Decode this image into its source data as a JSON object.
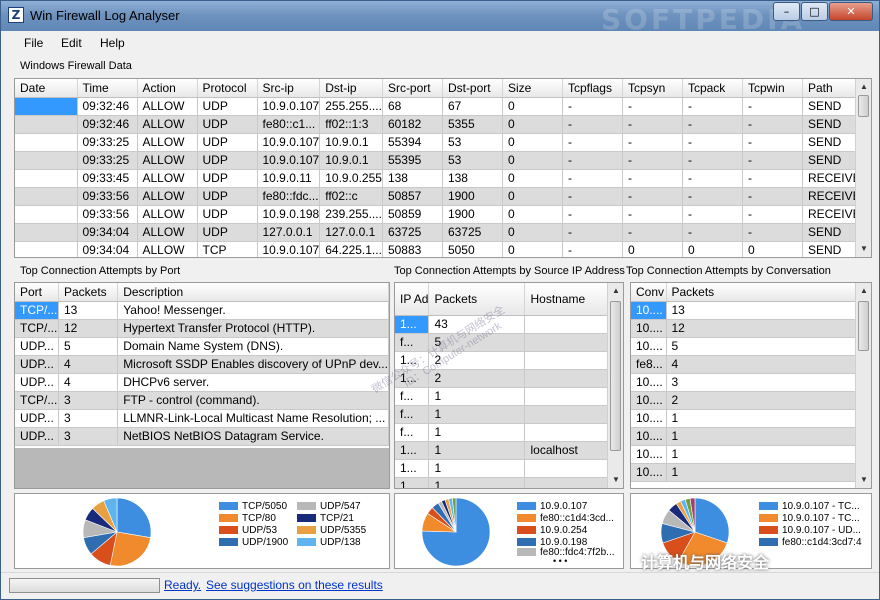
{
  "window": {
    "title": "Win Firewall Log Analyser",
    "icon": "Z",
    "watermark": "SOFTPEDIA"
  },
  "menu": [
    "File",
    "Edit",
    "Help"
  ],
  "log": {
    "label": "Windows Firewall Data",
    "columns": [
      "Date",
      "Time",
      "Action",
      "Protocol",
      "Src-ip",
      "Dst-ip",
      "Src-port",
      "Dst-port",
      "Size",
      "Tcpflags",
      "Tcpsyn",
      "Tcpack",
      "Tcpwin",
      "Path"
    ],
    "rows": [
      [
        "",
        "09:32:46",
        "ALLOW",
        "UDP",
        "10.9.0.107",
        "255.255....",
        "68",
        "67",
        "0",
        "-",
        "-",
        "-",
        "-",
        "SEND"
      ],
      [
        "",
        "09:32:46",
        "ALLOW",
        "UDP",
        "fe80::c1...",
        "ff02::1:3",
        "60182",
        "5355",
        "0",
        "-",
        "-",
        "-",
        "-",
        "SEND"
      ],
      [
        "",
        "09:33:25",
        "ALLOW",
        "UDP",
        "10.9.0.107",
        "10.9.0.1",
        "55394",
        "53",
        "0",
        "-",
        "-",
        "-",
        "-",
        "SEND"
      ],
      [
        "",
        "09:33:25",
        "ALLOW",
        "UDP",
        "10.9.0.107",
        "10.9.0.1",
        "55395",
        "53",
        "0",
        "-",
        "-",
        "-",
        "-",
        "SEND"
      ],
      [
        "",
        "09:33:45",
        "ALLOW",
        "UDP",
        "10.9.0.11",
        "10.9.0.255",
        "138",
        "138",
        "0",
        "-",
        "-",
        "-",
        "-",
        "RECEIVE"
      ],
      [
        "",
        "09:33:56",
        "ALLOW",
        "UDP",
        "fe80::fdc...",
        "ff02::c",
        "50857",
        "1900",
        "0",
        "-",
        "-",
        "-",
        "-",
        "RECEIVE"
      ],
      [
        "",
        "09:33:56",
        "ALLOW",
        "UDP",
        "10.9.0.198",
        "239.255....",
        "50859",
        "1900",
        "0",
        "-",
        "-",
        "-",
        "-",
        "RECEIVE"
      ],
      [
        "",
        "09:34:04",
        "ALLOW",
        "UDP",
        "127.0.0.1",
        "127.0.0.1",
        "63725",
        "63725",
        "0",
        "-",
        "-",
        "-",
        "-",
        "SEND"
      ],
      [
        "",
        "09:34:04",
        "ALLOW",
        "TCP",
        "10.9.0.107",
        "64.225.1...",
        "50883",
        "5050",
        "0",
        "-",
        "0",
        "0",
        "0",
        "SEND"
      ]
    ]
  },
  "by_port": {
    "label": "Top Connection Attempts by Port",
    "columns": [
      "Port",
      "Packets",
      "Description"
    ],
    "rows": [
      [
        "TCP/...",
        "13",
        "Yahoo! Messenger."
      ],
      [
        "TCP/...",
        "12",
        "Hypertext Transfer Protocol (HTTP)."
      ],
      [
        "UDP...",
        "5",
        "Domain Name System (DNS)."
      ],
      [
        "UDP...",
        "4",
        "Microsoft SSDP Enables discovery of UPnP dev..."
      ],
      [
        "UDP...",
        "4",
        "DHCPv6 server."
      ],
      [
        "TCP/...",
        "3",
        "FTP - control (command)."
      ],
      [
        "UDP...",
        "3",
        "LLMNR-Link-Local Multicast Name Resolution; ..."
      ],
      [
        "UDP...",
        "3",
        "NetBIOS NetBIOS Datagram Service."
      ]
    ]
  },
  "by_ip": {
    "label": "Top Connection Attempts by Source IP Address",
    "columns": [
      "IP Ad",
      "Packets",
      "Hostname"
    ],
    "rows": [
      [
        "1...",
        "43",
        ""
      ],
      [
        "f...",
        "5",
        ""
      ],
      [
        "1...",
        "2",
        ""
      ],
      [
        "1...",
        "2",
        ""
      ],
      [
        "f...",
        "1",
        ""
      ],
      [
        "f...",
        "1",
        ""
      ],
      [
        "f...",
        "1",
        ""
      ],
      [
        "1...",
        "1",
        "localhost"
      ],
      [
        "1...",
        "1",
        ""
      ],
      [
        "1...",
        "1",
        ""
      ]
    ]
  },
  "by_conv": {
    "label": "Top Connection Attempts by Conversation",
    "columns": [
      "Conv",
      "Packets"
    ],
    "rows": [
      [
        "10....",
        "13"
      ],
      [
        "10....",
        "12"
      ],
      [
        "10....",
        "5"
      ],
      [
        "fe8...",
        "4"
      ],
      [
        "10....",
        "3"
      ],
      [
        "10....",
        "2"
      ],
      [
        "10....",
        "1"
      ],
      [
        "10....",
        "1"
      ],
      [
        "10....",
        "1"
      ],
      [
        "10....",
        "1"
      ]
    ]
  },
  "pie_port": {
    "legend": [
      {
        "label": "TCP/5050",
        "color": "#3d8ee0"
      },
      {
        "label": "UDP/547",
        "color": "#b8b8b8"
      },
      {
        "label": "TCP/80",
        "color": "#f08a2c"
      },
      {
        "label": "TCP/21",
        "color": "#1a2a7a"
      },
      {
        "label": "UDP/53",
        "color": "#d84f1c"
      },
      {
        "label": "UDP/5355",
        "color": "#e8a040"
      },
      {
        "label": "UDP/1900",
        "color": "#2e6db0"
      },
      {
        "label": "UDP/138",
        "color": "#5fb4f0"
      }
    ],
    "slices": [
      {
        "value": 13,
        "color": "#3d8ee0"
      },
      {
        "value": 12,
        "color": "#f08a2c"
      },
      {
        "value": 5,
        "color": "#d84f1c"
      },
      {
        "value": 4,
        "color": "#2e6db0"
      },
      {
        "value": 4,
        "color": "#b8b8b8"
      },
      {
        "value": 3,
        "color": "#1a2a7a"
      },
      {
        "value": 3,
        "color": "#e8a040"
      },
      {
        "value": 3,
        "color": "#5fb4f0"
      }
    ]
  },
  "pie_ip": {
    "legend": [
      {
        "label": "10.9.0.107",
        "color": "#3d8ee0"
      },
      {
        "label": "fe80::c1d4:3cd...",
        "color": "#f08a2c"
      },
      {
        "label": "10.9.0.254",
        "color": "#d84f1c"
      },
      {
        "label": "10.9.0.198",
        "color": "#2e6db0"
      },
      {
        "label": "fe80::fdc4:7f2b...",
        "color": "#b8b8b8"
      }
    ],
    "more": "• • •",
    "slices": [
      {
        "value": 43,
        "color": "#3d8ee0"
      },
      {
        "value": 5,
        "color": "#f08a2c"
      },
      {
        "value": 2,
        "color": "#d84f1c"
      },
      {
        "value": 2,
        "color": "#2e6db0"
      },
      {
        "value": 1,
        "color": "#b8b8b8"
      },
      {
        "value": 1,
        "color": "#1a2a7a"
      },
      {
        "value": 1,
        "color": "#e8a040"
      },
      {
        "value": 1,
        "color": "#5fb4f0"
      },
      {
        "value": 1,
        "color": "#70a040"
      }
    ]
  },
  "pie_conv": {
    "legend": [
      {
        "label": "10.9.0.107 - TC...",
        "color": "#3d8ee0"
      },
      {
        "label": "10.9.0.107 - TC...",
        "color": "#f08a2c"
      },
      {
        "label": "10.9.0.107 - UD...",
        "color": "#d84f1c"
      },
      {
        "label": "fe80::c1d4:3cd7:4",
        "color": "#2e6db0"
      }
    ],
    "slices": [
      {
        "value": 13,
        "color": "#3d8ee0"
      },
      {
        "value": 12,
        "color": "#f08a2c"
      },
      {
        "value": 5,
        "color": "#d84f1c"
      },
      {
        "value": 4,
        "color": "#2e6db0"
      },
      {
        "value": 3,
        "color": "#b8b8b8"
      },
      {
        "value": 2,
        "color": "#1a2a7a"
      },
      {
        "value": 1,
        "color": "#e8a040"
      },
      {
        "value": 1,
        "color": "#5fb4f0"
      },
      {
        "value": 1,
        "color": "#70a040"
      },
      {
        "value": 1,
        "color": "#a04070"
      }
    ]
  },
  "status": {
    "text": "Ready.",
    "link": "See suggestions on these results",
    "progress": 0
  },
  "overlay": {
    "weibo": "计算机与网络安全",
    "diag1": "微信公众号：计算机与网络安全",
    "diag2": "ID：Computer-network"
  }
}
